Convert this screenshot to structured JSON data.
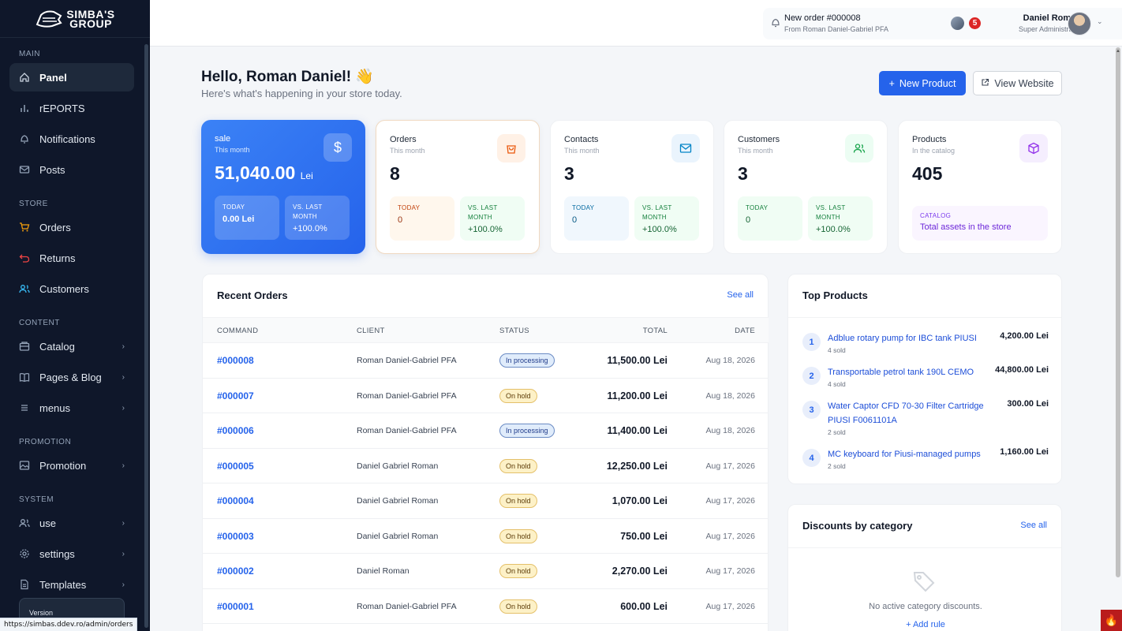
{
  "brand": {
    "logo_text": "SIMBA'S GROUP"
  },
  "sidebar": {
    "sections": [
      {
        "label": "MAIN",
        "items": [
          {
            "label": "Panel",
            "icon": "home-icon",
            "active": true
          },
          {
            "label": "rEPORTS",
            "icon": "bar-chart-icon"
          },
          {
            "label": "Notifications",
            "icon": "bell-icon"
          },
          {
            "label": "Posts",
            "icon": "mail-icon"
          }
        ]
      },
      {
        "label": "STORE",
        "items": [
          {
            "label": "Orders",
            "icon": "cart-icon"
          },
          {
            "label": "Returns",
            "icon": "return-icon"
          },
          {
            "label": "Customers",
            "icon": "users-icon"
          }
        ]
      },
      {
        "label": "CONTENT",
        "items": [
          {
            "label": "Catalog",
            "icon": "box-icon",
            "chevron": true
          },
          {
            "label": "Pages & Blog",
            "icon": "book-icon",
            "chevron": true
          },
          {
            "label": "menus",
            "icon": "list-icon",
            "chevron": true
          }
        ]
      },
      {
        "label": "PROMOTION",
        "items": [
          {
            "label": "Promotion",
            "icon": "image-icon",
            "chevron": true
          }
        ]
      },
      {
        "label": "SYSTEM",
        "items": [
          {
            "label": "use",
            "icon": "user-group-icon",
            "chevron": true
          },
          {
            "label": "settings",
            "icon": "gear-icon",
            "chevron": true
          },
          {
            "label": "Templates",
            "icon": "file-icon",
            "chevron": true
          }
        ]
      }
    ],
    "version_label": "Version"
  },
  "status_url": "https://simbas.ddev.ro/admin/orders",
  "topbar": {
    "notification_title": "New order #000008",
    "notification_sub": "From Roman Daniel-Gabriel PFA",
    "notification_count": "5",
    "user_name": "Daniel Roman",
    "user_role": "Super Administrator"
  },
  "greeting": {
    "title": "Hello, Roman Daniel! 👋",
    "subtitle": "Here's what's happening in your store today."
  },
  "actions": {
    "new_product": "New Product",
    "view_website": "View Website"
  },
  "stats": {
    "sale": {
      "title": "sale",
      "sub": "This month",
      "value": "51,040.00",
      "unit": "Lei",
      "today_label": "TODAY",
      "today_value": "0.00 Lei",
      "vs_label": "VS. LAST MONTH",
      "vs_value": "+100.0%"
    },
    "orders": {
      "title": "Orders",
      "sub": "This month",
      "value": "8",
      "today_label": "TODAY",
      "today_value": "0",
      "vs_label": "VS. LAST MONTH",
      "vs_value": "+100.0%"
    },
    "contacts": {
      "title": "Contacts",
      "sub": "This month",
      "value": "3",
      "today_label": "TODAY",
      "today_value": "0",
      "vs_label": "VS. LAST MONTH",
      "vs_value": "+100.0%"
    },
    "customers": {
      "title": "Customers",
      "sub": "This month",
      "value": "3",
      "today_label": "TODAY",
      "today_value": "0",
      "vs_label": "VS. LAST MONTH",
      "vs_value": "+100.0%"
    },
    "products": {
      "title": "Products",
      "sub": "In the catalog",
      "value": "405",
      "catalog_label": "CATALOG",
      "catalog_text": "Total assets in the store"
    }
  },
  "recent_orders": {
    "title": "Recent Orders",
    "see_all": "See all",
    "columns": [
      "COMMAND",
      "CLIENT",
      "STATUS",
      "TOTAL",
      "DATE"
    ],
    "rows": [
      {
        "cmd": "#000008",
        "client": "Roman Daniel-Gabriel PFA",
        "status": "In processing",
        "total": "11,500.00 Lei",
        "date": "Aug 18, 2026"
      },
      {
        "cmd": "#000007",
        "client": "Roman Daniel-Gabriel PFA",
        "status": "On hold",
        "total": "11,200.00 Lei",
        "date": "Aug 18, 2026"
      },
      {
        "cmd": "#000006",
        "client": "Roman Daniel-Gabriel PFA",
        "status": "In processing",
        "total": "11,400.00 Lei",
        "date": "Aug 18, 2026"
      },
      {
        "cmd": "#000005",
        "client": "Daniel Gabriel Roman",
        "status": "On hold",
        "total": "12,250.00 Lei",
        "date": "Aug 17, 2026"
      },
      {
        "cmd": "#000004",
        "client": "Daniel Gabriel Roman",
        "status": "On hold",
        "total": "1,070.00 Lei",
        "date": "Aug 17, 2026"
      },
      {
        "cmd": "#000003",
        "client": "Daniel Gabriel Roman",
        "status": "On hold",
        "total": "750.00 Lei",
        "date": "Aug 17, 2026"
      },
      {
        "cmd": "#000002",
        "client": "Daniel Roman",
        "status": "On hold",
        "total": "2,270.00 Lei",
        "date": "Aug 17, 2026"
      },
      {
        "cmd": "#000001",
        "client": "Roman Daniel-Gabriel PFA",
        "status": "On hold",
        "total": "600.00 Lei",
        "date": "Aug 17, 2026"
      }
    ]
  },
  "top_products": {
    "title": "Top Products",
    "items": [
      {
        "rank": "1",
        "name": "Adblue rotary pump for IBC tank PIUSI",
        "sold": "4 sold",
        "price": "4,200.00 Lei"
      },
      {
        "rank": "2",
        "name": "Transportable petrol tank 190L CEMO",
        "sold": "4 sold",
        "price": "44,800.00 Lei"
      },
      {
        "rank": "3",
        "name": "Water Captor CFD 70-30 Filter Cartridge PIUSI F0061101A",
        "sold": "2 sold",
        "price": "300.00 Lei"
      },
      {
        "rank": "4",
        "name": "MC keyboard for Piusi-managed pumps",
        "sold": "2 sold",
        "price": "1,160.00 Lei"
      }
    ]
  },
  "discounts": {
    "title": "Discounts by category",
    "see_all": "See all",
    "empty_text": "No active category discounts.",
    "add_rule": "+ Add rule"
  }
}
